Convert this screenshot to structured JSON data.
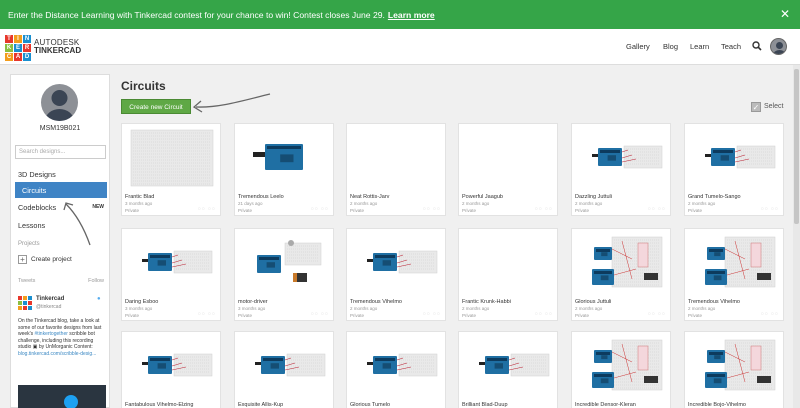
{
  "banner": {
    "text": "Enter the Distance Learning with Tinkercad contest for your chance to win! Contest closes June 29.",
    "link": "Learn more",
    "close_icon": "close-icon"
  },
  "brand": {
    "logo_letters": [
      "T",
      "I",
      "N",
      "K",
      "E",
      "R",
      "C",
      "A",
      "D"
    ],
    "logo_colors": [
      "#e7372b",
      "#f39c1b",
      "#1a8fcf",
      "#8bbf3f",
      "#1a8fcf",
      "#e7372b",
      "#f39c1b",
      "#e7372b",
      "#1a8fcf"
    ],
    "line1": "AUTODESK",
    "line2": "TINKERCAD"
  },
  "nav": {
    "gallery": "Gallery",
    "blog": "Blog",
    "learn": "Learn",
    "teach": "Teach",
    "search_icon": "search-icon"
  },
  "sidebar": {
    "username": "MSM19B021",
    "search_placeholder": "Search designs...",
    "items": [
      {
        "label": "3D Designs"
      },
      {
        "label": "Circuits"
      },
      {
        "label": "Codeblocks",
        "badge": "NEW"
      },
      {
        "label": "Lessons"
      }
    ],
    "projects_label": "Projects",
    "create_project": "Create project",
    "tweets_label": "Tweets",
    "follow_label": "Follow",
    "tweet": {
      "name": "Tinkercad",
      "handle": "@tinkercad",
      "text": "On the Tinkercad blog, take a look at some of our favorite designs from last week's",
      "hashtag": "#tinkertogether",
      "text2": "scribble bot challenge, including this recording studio",
      "text3": "by UnMorganic",
      "text4": "Content:",
      "link": "blog.tinkercad.com/scribble-desig..."
    }
  },
  "main": {
    "title": "Circuits",
    "create_button": "Create new Circuit",
    "select_label": "Select"
  },
  "cards": [
    {
      "name": "Frantic Blad",
      "ago": "3 months ago",
      "privacy": "Private",
      "thumb": "breadboard"
    },
    {
      "name": "Tremendous Leelo",
      "ago": "21 days ago",
      "privacy": "Private",
      "thumb": "arduino"
    },
    {
      "name": "Neat Rottis-Jarv",
      "ago": "2 months ago",
      "privacy": "Private",
      "thumb": "blank"
    },
    {
      "name": "Powerful Jaagub",
      "ago": "2 months ago",
      "privacy": "Private",
      "thumb": "blank"
    },
    {
      "name": "Dazzling Juttuli",
      "ago": "2 months ago",
      "privacy": "Private",
      "thumb": "arduino-bb"
    },
    {
      "name": "Grand Tumelo-Sango",
      "ago": "2 months ago",
      "privacy": "Private",
      "thumb": "arduino-bb"
    },
    {
      "name": "Daring Esboo",
      "ago": "3 months ago",
      "privacy": "Private",
      "thumb": "arduino-bb"
    },
    {
      "name": "motor-driver",
      "ago": "3 months ago",
      "privacy": "Private",
      "thumb": "motor"
    },
    {
      "name": "Tremendous Vihelmo",
      "ago": "2 months ago",
      "privacy": "Private",
      "thumb": "arduino-bb"
    },
    {
      "name": "Frantic Krunk-Habbi",
      "ago": "2 months ago",
      "privacy": "Private",
      "thumb": "blank"
    },
    {
      "name": "Glorious Juttuli",
      "ago": "2 months ago",
      "privacy": "Private",
      "thumb": "complex"
    },
    {
      "name": "Tremendous Vihelmo",
      "ago": "2 months ago",
      "privacy": "Private",
      "thumb": "complex"
    },
    {
      "name": "Fantabulous Vihelmo-Elzing",
      "ago": "",
      "privacy": "",
      "thumb": "arduino-bb"
    },
    {
      "name": "Exquisite Allis-Kup",
      "ago": "",
      "privacy": "",
      "thumb": "arduino-bb"
    },
    {
      "name": "Glorious Tumelo",
      "ago": "",
      "privacy": "",
      "thumb": "arduino-bb"
    },
    {
      "name": "Brilliant Blad-Duup",
      "ago": "",
      "privacy": "",
      "thumb": "arduino-bb"
    },
    {
      "name": "Incredible Densor-Kleran",
      "ago": "",
      "privacy": "",
      "thumb": "complex"
    },
    {
      "name": "Incredible Bojo-Vihelmo",
      "ago": "",
      "privacy": "",
      "thumb": "complex"
    }
  ]
}
